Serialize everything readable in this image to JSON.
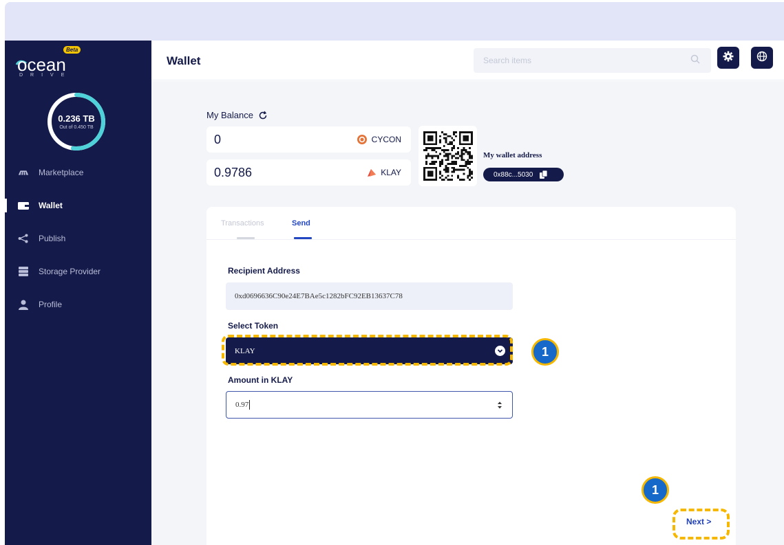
{
  "sidebar": {
    "logo_word": "ocean",
    "logo_badge": "Beta",
    "logo_sub": "DRIVE",
    "storage": {
      "used": "0.236 TB",
      "total": "Out of 0.450 TB",
      "fraction_used": 0.52
    },
    "items": [
      {
        "label": "Marketplace",
        "icon": "marketplace-icon"
      },
      {
        "label": "Wallet",
        "icon": "wallet-icon",
        "active": true
      },
      {
        "label": "Publish",
        "icon": "share-icon"
      },
      {
        "label": "Storage Provider",
        "icon": "server-icon"
      },
      {
        "label": "Profile",
        "icon": "user-icon"
      }
    ]
  },
  "header": {
    "title": "Wallet",
    "search_placeholder": "Search items",
    "settings_icon": "gear-icon",
    "language_icon": "globe-icon"
  },
  "balance": {
    "title": "My Balance",
    "rows": [
      {
        "amount": "0",
        "token": "CYCON",
        "color": "#e3743a"
      },
      {
        "amount": "0.9786",
        "token": "KLAY",
        "color": "#e34a3c"
      }
    ],
    "wallet_address_label": "My wallet address",
    "wallet_address": "0x88c...5030"
  },
  "tabs": [
    "Transactions",
    "Send"
  ],
  "active_tab": "Send",
  "form": {
    "recipient_label": "Recipient Address",
    "recipient_value": "0xd0696636C90e24E7BAe5c1282bFC92EB13637C78",
    "token_label": "Select Token",
    "token_value": "KLAY",
    "amount_label": "Amount in KLAY",
    "amount_value": "0.97",
    "next_label": "Next >"
  },
  "annotations": {
    "step_1": "1",
    "step_2": "1",
    "highlight_color": "#f5b700",
    "badge_color": "#1669c8"
  },
  "colors": {
    "sidebar": "#141a49",
    "accent": "#2347c2"
  }
}
